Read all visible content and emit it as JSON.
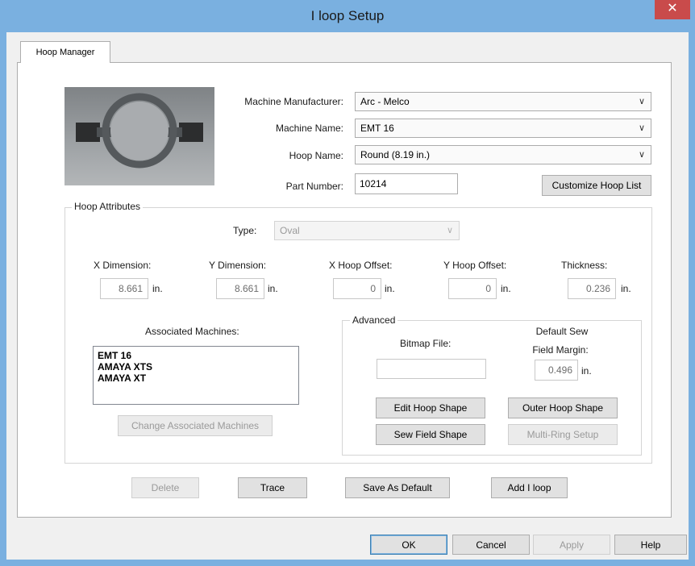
{
  "window": {
    "title": "I loop Setup",
    "close_glyph": "✕"
  },
  "tabs": [
    {
      "label": "Hoop Manager",
      "active": true
    }
  ],
  "hoop_image": {
    "alt": "Round hoop photo"
  },
  "machine": {
    "manufacturer_label": "Machine Manufacturer:",
    "manufacturer_value": "Arc - Melco",
    "name_label": "Machine Name:",
    "name_value": "EMT 16",
    "hoop_name_label": "Hoop Name:",
    "hoop_name_value": "Round (8.19 in.)",
    "part_number_label": "Part Number:",
    "part_number_value": "10214",
    "customize_button": "Customize Hoop List",
    "dropdown_arrow": "∨"
  },
  "attributes": {
    "group_title": "Hoop Attributes",
    "type_label": "Type:",
    "type_value": "Oval",
    "unit": "in.",
    "fields": [
      {
        "label": "X Dimension:",
        "value": "8.661"
      },
      {
        "label": "Y Dimension:",
        "value": "8.661"
      },
      {
        "label": "X Hoop Offset:",
        "value": "0"
      },
      {
        "label": "Y Hoop Offset:",
        "value": "0"
      },
      {
        "label": "Thickness:",
        "value": "0.236"
      }
    ]
  },
  "associated": {
    "label": "Associated Machines:",
    "items": [
      "EMT 16",
      "AMAYA XTS",
      "AMAYA XT"
    ],
    "change_button": "Change Associated Machines"
  },
  "advanced": {
    "group_title": "Advanced",
    "bitmap_label": "Bitmap File:",
    "bitmap_value": "",
    "margin_label_line1": "Default Sew",
    "margin_label_line2": "Field Margin:",
    "margin_value": "0.496",
    "margin_unit": "in.",
    "edit_hoop_button": "Edit Hoop Shape",
    "outer_hoop_button": "Outer Hoop Shape",
    "sew_field_button": "Sew Field Shape",
    "multi_ring_button": "Multi-Ring Setup"
  },
  "actions": {
    "delete": "Delete",
    "trace": "Trace",
    "save_default": "Save As Default",
    "add_hoop": "Add I loop"
  },
  "dialog_buttons": {
    "ok": "OK",
    "cancel": "Cancel",
    "apply": "Apply",
    "help": "Help"
  },
  "colors": {
    "title_bar": "#7ab0e0",
    "close_button": "#c94b4b",
    "disabled_text": "#9a9a9a"
  }
}
